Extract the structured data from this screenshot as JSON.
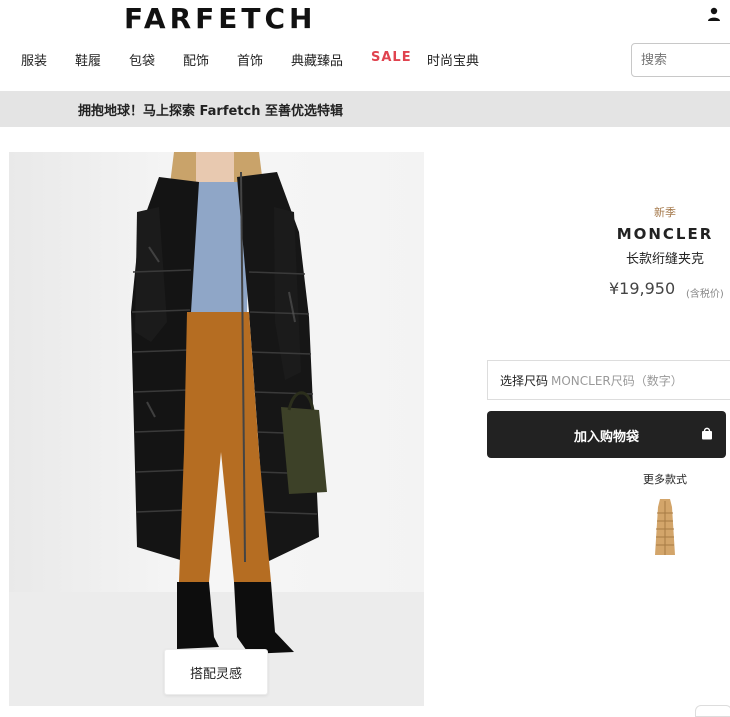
{
  "header": {
    "logo": "FARFETCH",
    "account_icon": "user-icon"
  },
  "nav": {
    "items": [
      {
        "label": "服装"
      },
      {
        "label": "鞋履"
      },
      {
        "label": "包袋"
      },
      {
        "label": "配饰"
      },
      {
        "label": "首饰"
      },
      {
        "label": "典藏臻品"
      },
      {
        "label": "SALE"
      },
      {
        "label": "时尚宝典"
      }
    ],
    "sale_color": "#e0434f"
  },
  "search": {
    "placeholder": "搜索"
  },
  "banner": {
    "text": "拥抱地球！马上探索 Farfetch 至善优选特辑"
  },
  "gallery": {
    "style_button": "搭配灵感"
  },
  "product": {
    "season": "新季",
    "brand": "MONCLER",
    "name": "长款绗缝夹克",
    "price": "¥19,950",
    "tax_note": "(含税价)",
    "size_label": "选择尺码",
    "size_placeholder": "MONCLER尺码（数字）",
    "add_to_bag": "加入购物袋",
    "bag_icon": "shopping-bag-icon",
    "more_styles": "更多款式",
    "season_color": "#a67b4e",
    "button_color": "#222222"
  }
}
